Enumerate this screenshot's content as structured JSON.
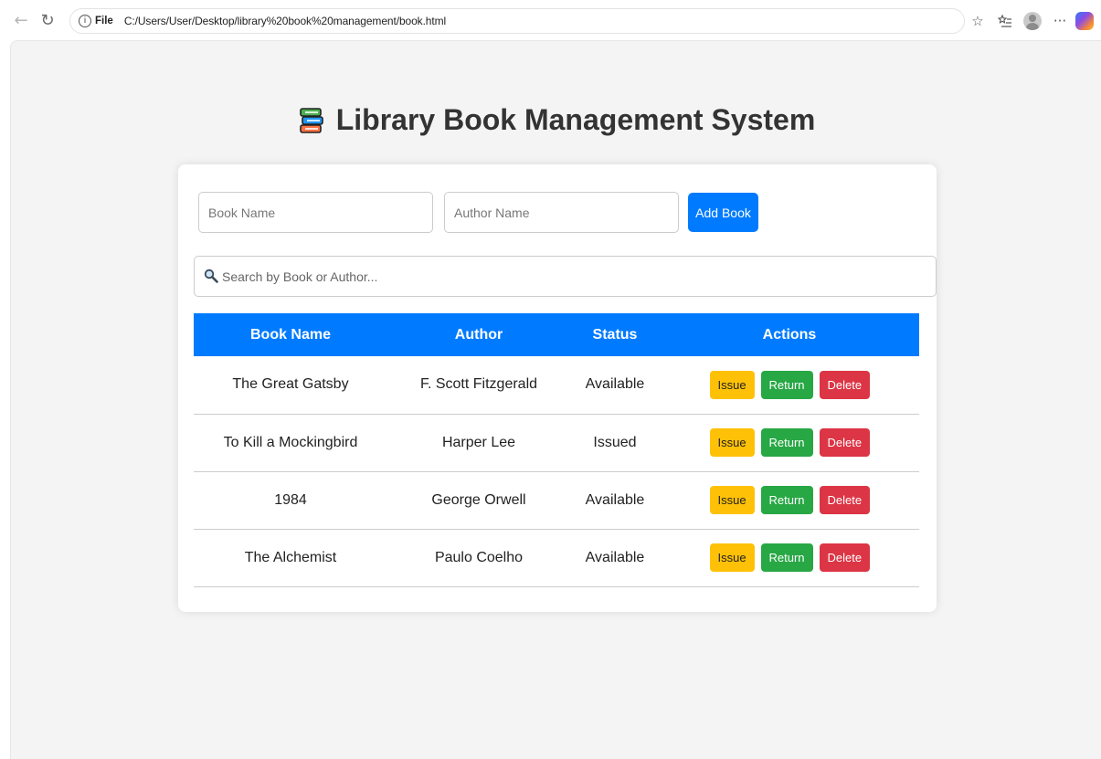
{
  "browser": {
    "file_label": "File",
    "url": "C:/Users/User/Desktop/library%20book%20management/book.html",
    "more_label": "···"
  },
  "page": {
    "title": "Library Book Management System"
  },
  "form": {
    "book_placeholder": "Book Name",
    "author_placeholder": "Author Name",
    "add_label": "Add Book"
  },
  "search": {
    "placeholder": "Search by Book or Author..."
  },
  "table": {
    "headers": [
      "Book Name",
      "Author",
      "Status",
      "Actions"
    ],
    "rows": [
      {
        "name": "The Great Gatsby",
        "author": "F. Scott Fitzgerald",
        "status": "Available"
      },
      {
        "name": "To Kill a Mockingbird",
        "author": "Harper Lee",
        "status": "Issued"
      },
      {
        "name": "1984",
        "author": "George Orwell",
        "status": "Available"
      },
      {
        "name": "The Alchemist",
        "author": "Paulo Coelho",
        "status": "Available"
      }
    ],
    "actions": {
      "issue": "Issue",
      "return": "Return",
      "delete": "Delete"
    }
  },
  "colors": {
    "primary": "#007bff",
    "issue": "#ffc107",
    "return": "#28a745",
    "delete": "#dc3545"
  },
  "icons": [
    "back-arrow-icon",
    "reload-icon",
    "info-icon",
    "favorite-star-icon",
    "favorites-list-icon",
    "profile-avatar-icon",
    "more-icon",
    "copilot-icon",
    "books-icon",
    "magnifier-icon"
  ]
}
